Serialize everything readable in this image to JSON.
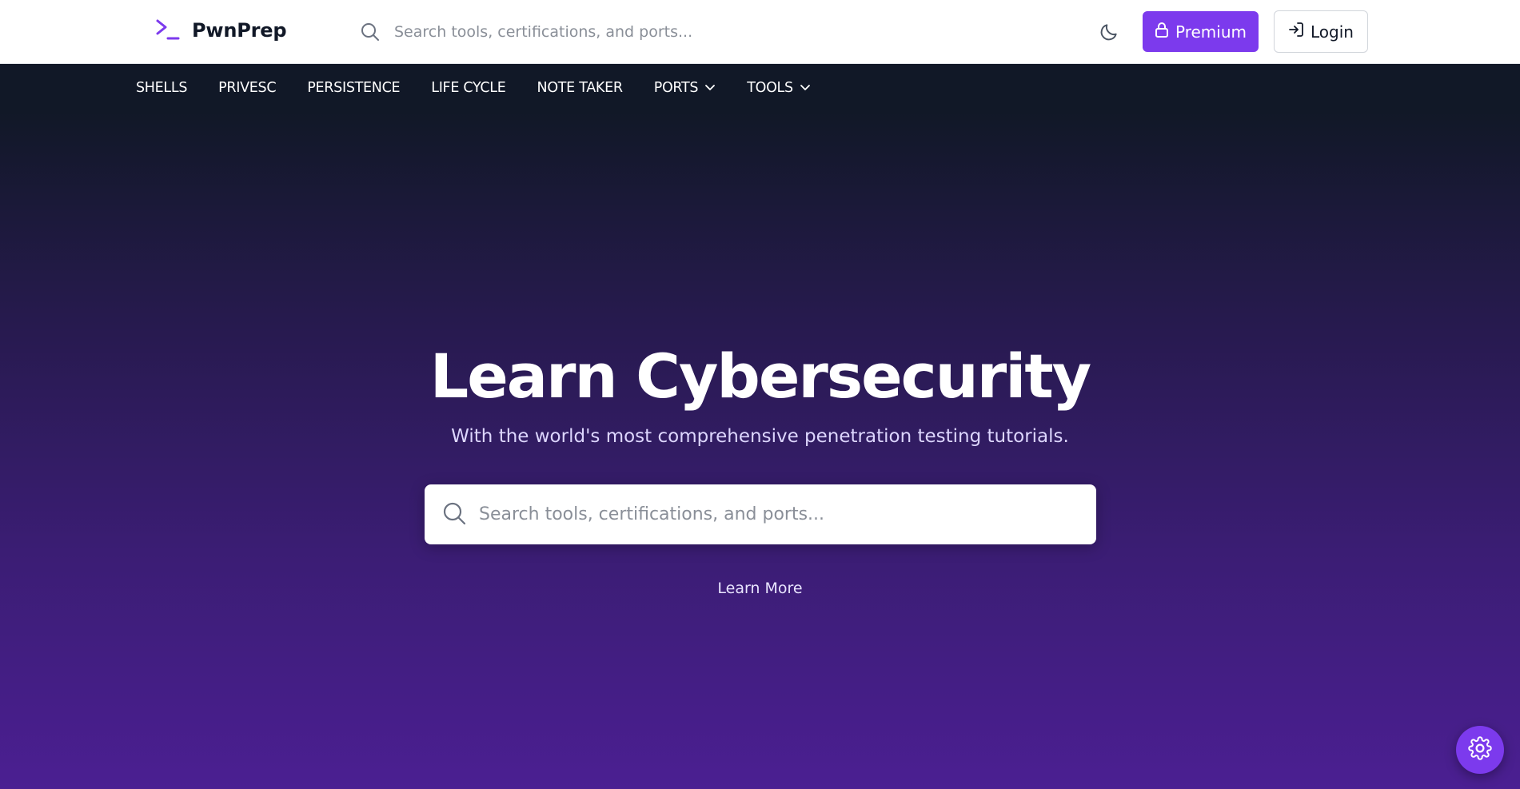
{
  "brand": {
    "name": "PwnPrep",
    "logo_icon": "terminal-prompt-icon",
    "accent_color": "#7c3aed"
  },
  "header": {
    "search": {
      "icon": "search-icon",
      "placeholder": "Search tools, certifications, and ports..."
    },
    "theme_toggle_icon": "moon-icon",
    "premium": {
      "label": "Premium",
      "icon": "lock-icon"
    },
    "login": {
      "label": "Login",
      "icon": "login-arrow-icon"
    }
  },
  "nav": {
    "items": [
      {
        "label": "SHELLS",
        "dropdown": false
      },
      {
        "label": "PRIVESC",
        "dropdown": false
      },
      {
        "label": "PERSISTENCE",
        "dropdown": false
      },
      {
        "label": "LIFE CYCLE",
        "dropdown": false
      },
      {
        "label": "NOTE TAKER",
        "dropdown": false
      },
      {
        "label": "PORTS",
        "dropdown": true
      },
      {
        "label": "TOOLS",
        "dropdown": true
      }
    ]
  },
  "hero": {
    "title": "Learn Cybersecurity",
    "subtitle": "With the world's most comprehensive penetration testing tutorials.",
    "search": {
      "icon": "search-icon",
      "placeholder": "Search tools, certifications, and ports..."
    },
    "learn_more": "Learn More"
  },
  "fab": {
    "icon": "gear-icon"
  }
}
